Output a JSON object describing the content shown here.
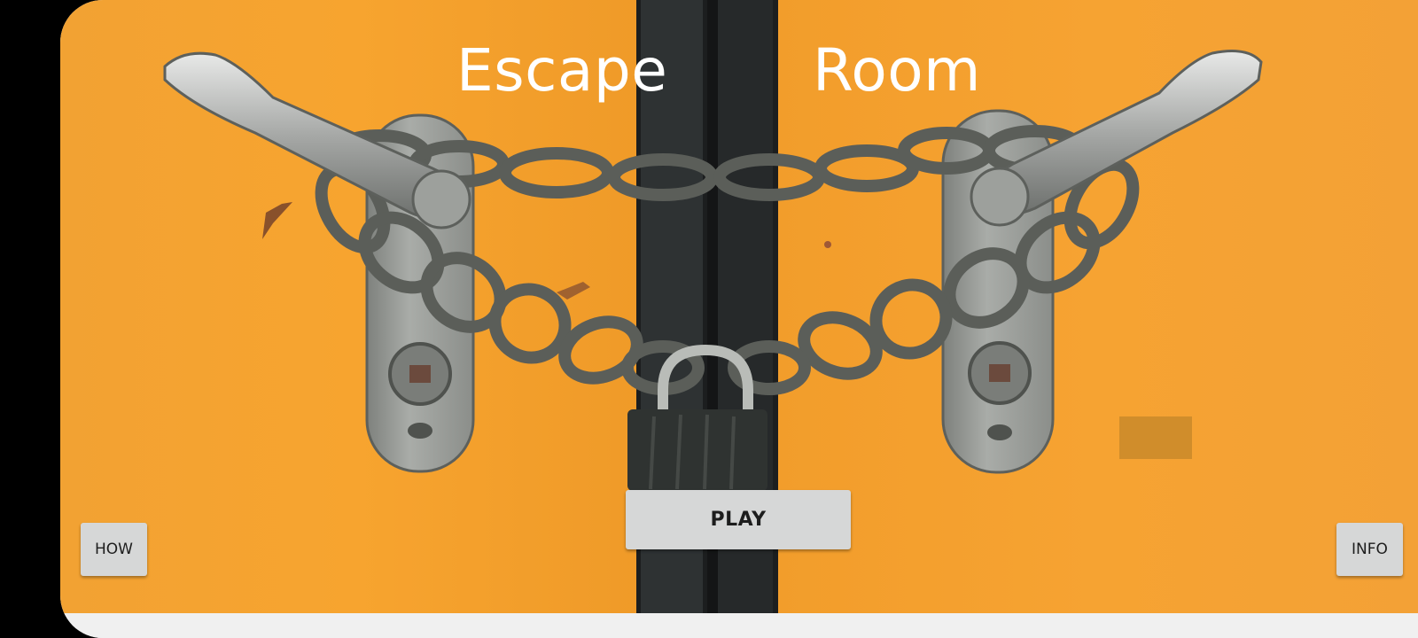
{
  "game": {
    "title_words": [
      "Escape",
      "Room"
    ]
  },
  "buttons": {
    "play": "PLAY",
    "how": "HOW",
    "info": "INFO"
  },
  "colors": {
    "door_orange": "#f4a233",
    "door_gap": "#1f2122",
    "metal": "#9da09c",
    "chain": "#5f625d",
    "button_bg": "#d6d7d7",
    "title_text": "#ffffff"
  }
}
